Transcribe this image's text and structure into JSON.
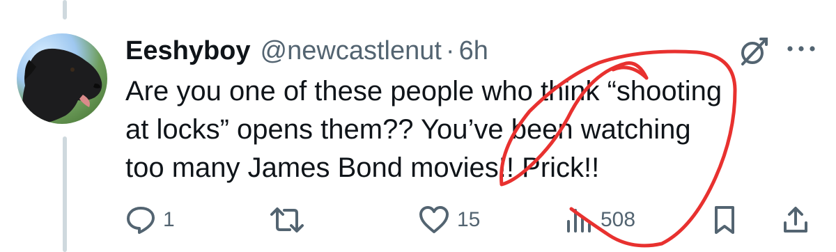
{
  "tweet": {
    "display_name": "Eeshyboy",
    "handle": "@newcastlenut",
    "separator": "·",
    "time": "6h",
    "text_lines": [
      "Are you one of these people who think “shooting",
      "at locks” opens them??  You’ve been watching",
      "too many James Bond movies!!   Prick!!"
    ]
  },
  "actions": {
    "replies": "1",
    "retweets": "",
    "likes": "15",
    "views": "508"
  },
  "icons": {
    "reply": "reply-icon",
    "retweet": "retweet-icon",
    "like": "heart-icon",
    "views": "views-chart-icon",
    "bookmark": "bookmark-icon",
    "share": "share-icon",
    "grok": "grok-icon",
    "more": "more-icon"
  },
  "colors": {
    "text_primary": "#0f1419",
    "text_secondary": "#536471",
    "thread_line": "#cfd9de",
    "annotation_red": "#e8312f"
  }
}
